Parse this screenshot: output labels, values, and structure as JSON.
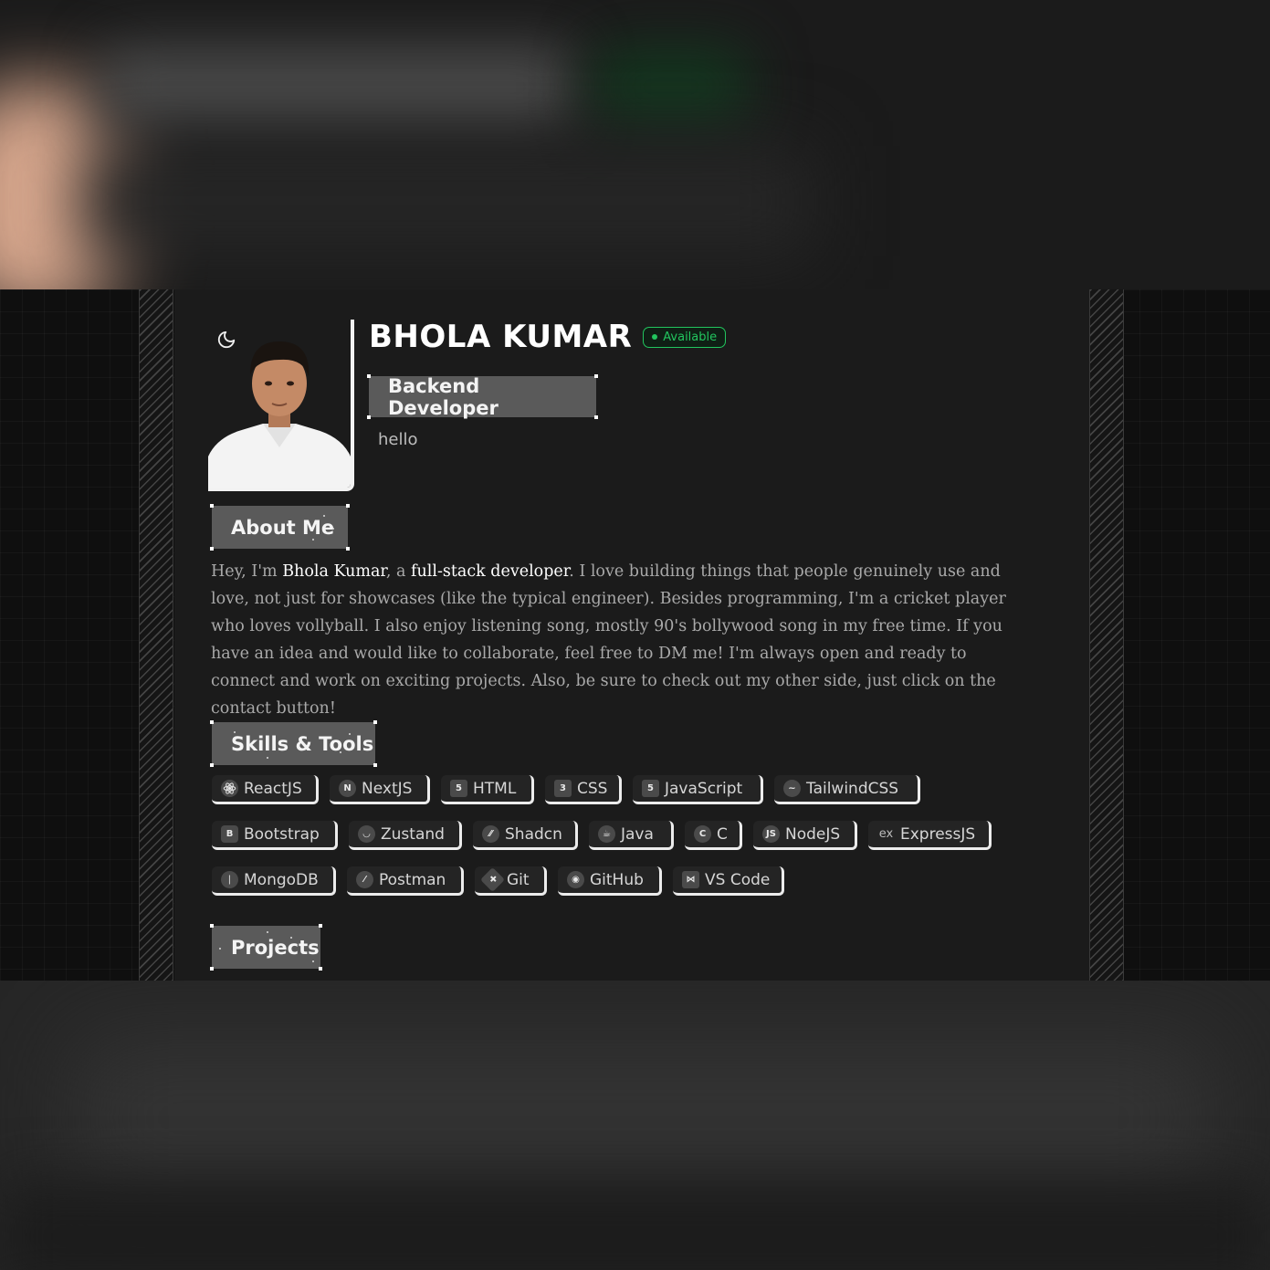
{
  "profile": {
    "name": "BHOLA KUMAR",
    "status": "Available",
    "role": "Backend Developer",
    "tagline": "hello",
    "theme_toggle_icon": "moon-icon",
    "status_color": "#22c55e"
  },
  "about": {
    "heading": "About Me",
    "p1": "Hey, I'm ",
    "name": "Bhola Kumar",
    "p2": ", a ",
    "role": "full-stack developer",
    "p3": ". I love building things that people genuinely use and love, not just for showcases (like the typical engineer). Besides programming, I'm a cricket player who loves vollyball. I also enjoy listening song, mostly 90's bollywood song in my free time. If you have an idea and would like to collaborate, feel free to DM me! I'm always open and ready to connect and work on exciting projects. Also, be sure to check out my other side, just click on the contact button!"
  },
  "skills": {
    "heading": "Skills & Tools",
    "items": [
      {
        "label": "ReactJS",
        "icon": "react-icon"
      },
      {
        "label": "NextJS",
        "icon": "nextjs-icon"
      },
      {
        "label": "HTML",
        "icon": "html5-icon"
      },
      {
        "label": "CSS",
        "icon": "css3-icon"
      },
      {
        "label": "JavaScript",
        "icon": "javascript-icon"
      },
      {
        "label": "TailwindCSS",
        "icon": "tailwind-icon"
      },
      {
        "label": "Bootstrap",
        "icon": "bootstrap-icon"
      },
      {
        "label": "Zustand",
        "icon": "zustand-icon"
      },
      {
        "label": "Shadcn",
        "icon": "shadcn-icon"
      },
      {
        "label": "Java",
        "icon": "java-icon"
      },
      {
        "label": "C",
        "icon": "c-icon"
      },
      {
        "label": "NodeJS",
        "icon": "nodejs-icon"
      },
      {
        "label": "ExpressJS",
        "icon": "expressjs-icon"
      },
      {
        "label": "MongoDB",
        "icon": "mongodb-icon"
      },
      {
        "label": "Postman",
        "icon": "postman-icon"
      },
      {
        "label": "Git",
        "icon": "git-icon"
      },
      {
        "label": "GitHub",
        "icon": "github-icon"
      },
      {
        "label": "VS Code",
        "icon": "vscode-icon"
      }
    ]
  },
  "projects": {
    "heading": "Projects"
  }
}
